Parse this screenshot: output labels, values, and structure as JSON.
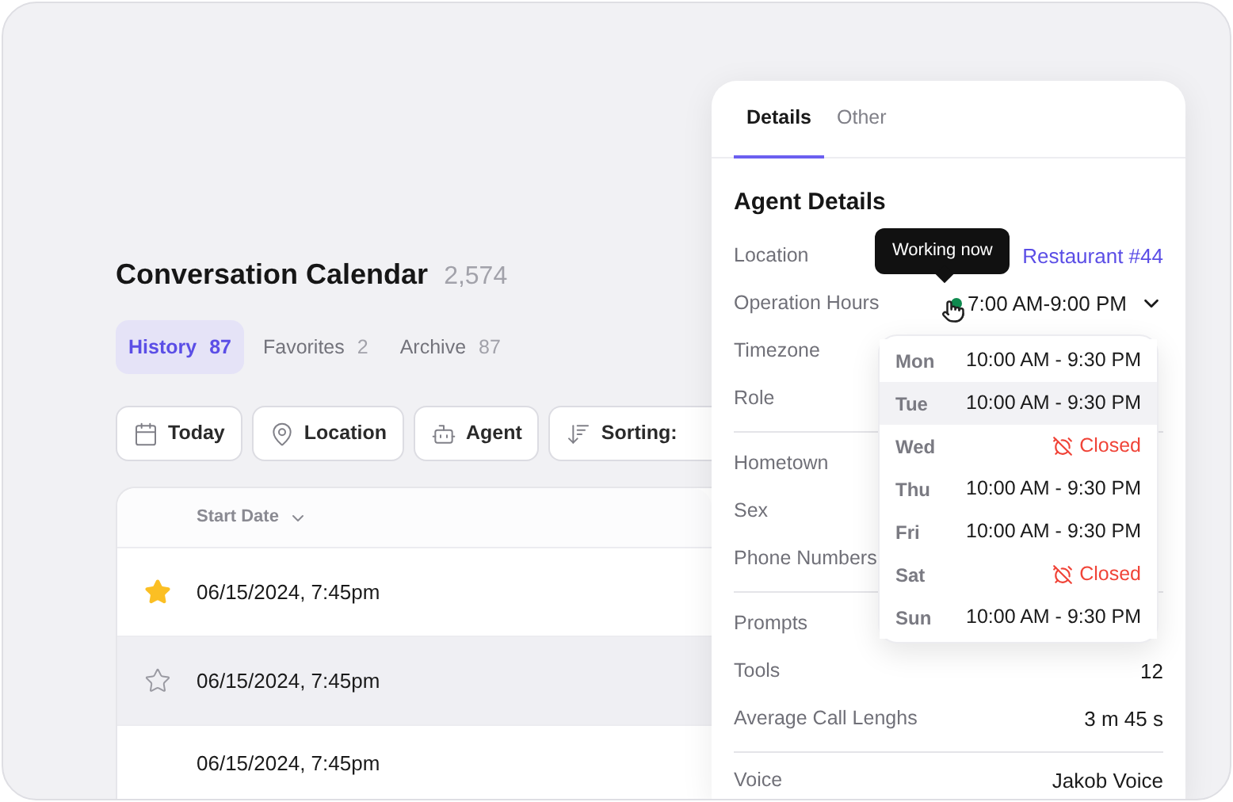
{
  "header": {
    "title": "Conversation Calendar",
    "count": "2,574"
  },
  "tabs": [
    {
      "label": "History",
      "count": "87",
      "selected": true
    },
    {
      "label": "Favorites",
      "count": "2",
      "selected": false
    },
    {
      "label": "Archive",
      "count": "87",
      "selected": false
    }
  ],
  "filters": [
    {
      "label": "Today"
    },
    {
      "label": "Location"
    },
    {
      "label": "Agent"
    },
    {
      "label": "Sorting:"
    }
  ],
  "table": {
    "columns": [
      {
        "label": "Start Date"
      }
    ],
    "rows": [
      {
        "start_date": "06/15/2024, 7:45pm",
        "favorite": true,
        "highlighted": false
      },
      {
        "start_date": "06/15/2024, 7:45pm",
        "favorite": false,
        "highlighted": true
      },
      {
        "start_date": "06/15/2024, 7:45pm",
        "highlighted": false
      }
    ]
  },
  "panel": {
    "tabs": [
      {
        "label": "Details",
        "selected": true
      },
      {
        "label": "Other",
        "selected": false
      }
    ],
    "title": "Agent Details",
    "sections": [
      [
        {
          "kind": "link",
          "label": "Location",
          "value": "Restaurant #44"
        },
        {
          "kind": "hours",
          "label": "Operation Hours",
          "value": "7:00 AM-9:00 PM",
          "working": true,
          "expanded": true
        },
        {
          "kind": "text",
          "label": "Timezone"
        },
        {
          "kind": "text",
          "label": "Role"
        }
      ],
      [
        {
          "kind": "text",
          "label": "Hometown"
        },
        {
          "kind": "text",
          "label": "Sex"
        },
        {
          "kind": "text",
          "label": "Phone Numbers"
        }
      ],
      [
        {
          "kind": "text",
          "label": "Prompts"
        },
        {
          "kind": "text",
          "label": "Tools",
          "value": "12"
        },
        {
          "kind": "text",
          "label": "Average Call Lenghs",
          "value": "3 m 45 s"
        }
      ],
      [
        {
          "kind": "text",
          "label": "Voice",
          "value": "Jakob Voice"
        }
      ]
    ],
    "tooltip": "Working now",
    "schedule": [
      {
        "day": "Mon",
        "kind": "open",
        "hours": "10:00 AM - 9:30 PM",
        "highlighted": false
      },
      {
        "day": "Tue",
        "kind": "open",
        "hours": "10:00 AM - 9:30 PM",
        "highlighted": true
      },
      {
        "day": "Wed",
        "kind": "closed",
        "hours": "Closed",
        "highlighted": false
      },
      {
        "day": "Thu",
        "kind": "open",
        "hours": "10:00 AM - 9:30 PM",
        "highlighted": false
      },
      {
        "day": "Fri",
        "kind": "open",
        "hours": "10:00 AM - 9:30 PM",
        "highlighted": false
      },
      {
        "day": "Sat",
        "kind": "closed",
        "hours": "Closed",
        "highlighted": false
      },
      {
        "day": "Sun",
        "kind": "open",
        "hours": "10:00 AM - 9:30 PM",
        "highlighted": false
      }
    ]
  }
}
